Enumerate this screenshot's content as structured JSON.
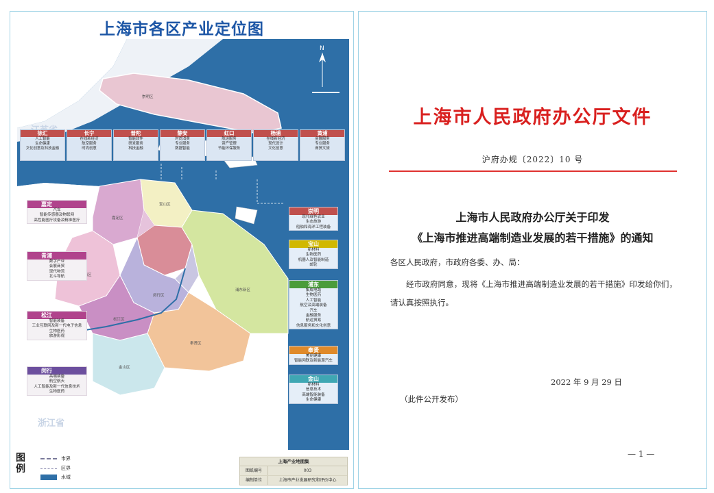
{
  "map": {
    "title": "上海市各区产业定位图",
    "province_north": "江苏省",
    "province_south": "浙江省",
    "districts_map_labels": {
      "chongming": "崇明区",
      "baoshan": "宝山区",
      "jiading": "嘉定区",
      "qingpu": "青浦区",
      "songjiang": "松江区",
      "minhang": "闵行区",
      "pudong": "浦东新区",
      "fengxian": "奉贤区",
      "jinshan": "金山区"
    },
    "center_boxes": [
      {
        "name": "徐汇",
        "color": "#c0504d",
        "lines": [
          "人工智能",
          "生命健康",
          "文化创意及科技金融"
        ]
      },
      {
        "name": "长宁",
        "color": "#c0504d",
        "lines": [
          "在线新经济",
          "航空服务",
          "时尚创意"
        ]
      },
      {
        "name": "普陀",
        "color": "#c0504d",
        "lines": [
          "智能软件",
          "研发服务",
          "科技金融"
        ]
      },
      {
        "name": "静安",
        "color": "#c0504d",
        "lines": [
          "时尚消费",
          "专业服务",
          "数据智能"
        ]
      },
      {
        "name": "虹口",
        "color": "#c0504d",
        "lines": [
          "航运服务",
          "资产管理",
          "节能环保服务"
        ]
      },
      {
        "name": "杨浦",
        "color": "#c0504d",
        "lines": [
          "在线新经济",
          "现代设计",
          "文化创意"
        ]
      },
      {
        "name": "黄浦",
        "color": "#c0504d",
        "lines": [
          "金融服务",
          "专业服务",
          "商贸文旅"
        ]
      }
    ],
    "left_boxes": [
      {
        "name": "嘉定",
        "color": "#b0438c",
        "lines": [
          "汽车",
          "智能传感器及物联网",
          "高性能医疗设备及精准医疗"
        ]
      },
      {
        "name": "青浦",
        "color": "#b0438c",
        "lines": [
          "数字产业",
          "会展商贸",
          "现代物流",
          "北斗导航"
        ]
      },
      {
        "name": "松江",
        "color": "#b0438c",
        "lines": [
          "智能装备",
          "工业互联网及新一代电子信息",
          "生物医药",
          "旅游影视"
        ]
      },
      {
        "name": "闵行",
        "color": "#6c4f9e",
        "lines": [
          "高端装备",
          "航空航天",
          "人工智能及新一代信息技术",
          "生物医药"
        ]
      }
    ],
    "right_boxes": [
      {
        "name": "崇明",
        "color": "#c0504d",
        "lines": [
          "现代绿色农业",
          "生态旅游",
          "船舶和海洋工程装备"
        ]
      },
      {
        "name": "宝山",
        "color": "#d1b800",
        "lines": [
          "新材料",
          "生物医药",
          "机器人及智能制造",
          "邮轮"
        ]
      },
      {
        "name": "浦东",
        "color": "#4a9c3a",
        "lines": [
          "集成电路",
          "生物医药",
          "人工智能",
          "航空及高端装备",
          "汽车",
          "金融服务",
          "航运贸易",
          "信息服务和文化创意"
        ]
      },
      {
        "name": "奉贤",
        "color": "#e08a2a",
        "lines": [
          "美丽健康",
          "智能网联及新能源汽车"
        ]
      },
      {
        "name": "金山",
        "color": "#3fa7b3",
        "lines": [
          "新材料",
          "信息技术",
          "高端智能装备",
          "生命健康"
        ]
      }
    ],
    "legend": {
      "title": "图例",
      "items": [
        "市界",
        "区界",
        "水域"
      ]
    },
    "atlas": {
      "title": "上海产业地图集",
      "rows": [
        {
          "key": "图纸编号",
          "value": "003"
        },
        {
          "key": "编制单位",
          "value": "上海市产业发展研究和评价中心"
        }
      ]
    },
    "colors": {
      "sea": "#2e6fa7",
      "land_outside": "#ffffff",
      "title": "#1e57a6"
    }
  },
  "document": {
    "issuer": "上海市人民政府办公厅文件",
    "number": "沪府办规〔2022〕10 号",
    "title_line1": "上海市人民政府办公厅关于印发",
    "title_line2": "《上海市推进高端制造业发展的若干措施》的通知",
    "salutation": "各区人民政府，市政府各委、办、局：",
    "body": "经市政府同意，现将《上海市推进高端制造业发展的若干措施》印发给你们，请认真按照执行。",
    "date": "2022 年 9 月 29 日",
    "note": "（此件公开发布）",
    "page": "— 1 —",
    "colors": {
      "issuer": "#d9201f",
      "rule": "#e0302e"
    }
  }
}
